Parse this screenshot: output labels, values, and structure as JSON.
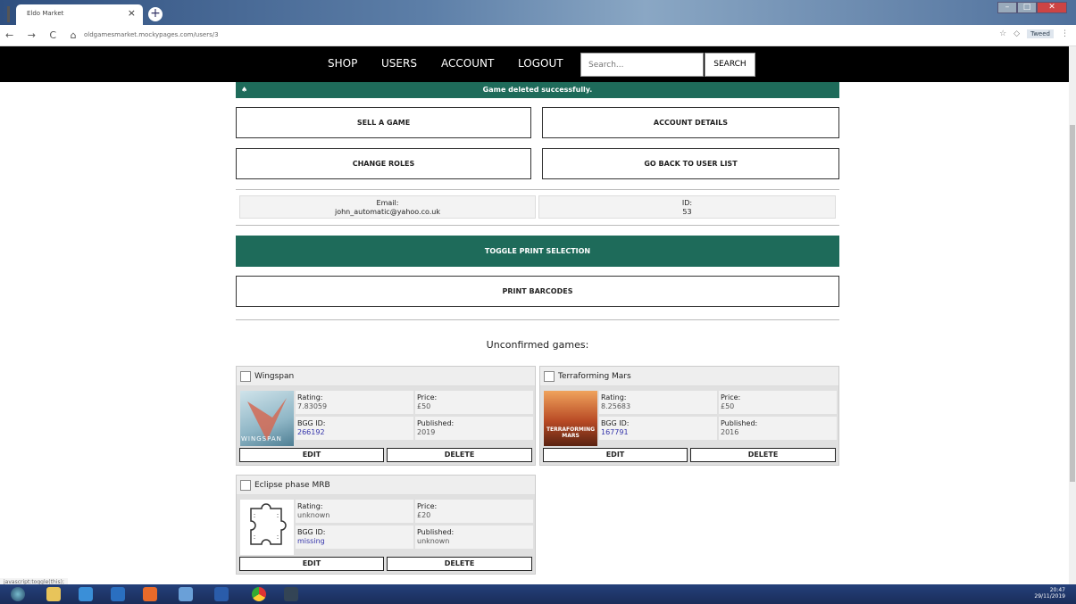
{
  "browser": {
    "tab_title": "Eldo Market",
    "tab_close": "×",
    "new_tab": "+",
    "nav_glyphs": "← → C ⌂",
    "url": "oldgamesmarket.mockypages.com/users/3",
    "toolbar_label": "Tweed",
    "window_min": "–",
    "window_max": "□",
    "window_close": "✕"
  },
  "nav": {
    "shop": "SHOP",
    "users": "USERS",
    "account": "ACCOUNT",
    "logout": "LOGOUT",
    "search_placeholder": "Search...",
    "search_button": "SEARCH"
  },
  "flash": {
    "icon": "♠",
    "message": "Game deleted successfully."
  },
  "actions": {
    "sell": "SELL A GAME",
    "account_details": "ACCOUNT DETAILS",
    "change_roles": "CHANGE ROLES",
    "back": "GO BACK TO USER LIST"
  },
  "user": {
    "email_label": "Email:",
    "email": "john_automatic@yahoo.co.uk",
    "id_label": "ID:",
    "id": "53"
  },
  "toggle_print": "TOGGLE PRINT SELECTION",
  "print_barcodes": "PRINT BARCODES",
  "unconfirmed_heading": "Unconfirmed games:",
  "labels": {
    "rating": "Rating:",
    "price": "Price:",
    "bgg": "BGG ID:",
    "published": "Published:",
    "edit": "EDIT",
    "delete": "DELETE"
  },
  "games": [
    {
      "name": "Wingspan",
      "rating": "7.83059",
      "price": "£50",
      "bgg_id": "266192",
      "published": "2019",
      "cover_text": "WINGSPAN"
    },
    {
      "name": "Terraforming Mars",
      "rating": "8.25683",
      "price": "£50",
      "bgg_id": "167791",
      "published": "2016",
      "cover_text": "TERRAFORMING MARS"
    },
    {
      "name": "Eclipse phase MRB",
      "rating": "unknown",
      "price": "£20",
      "bgg_id": "missing",
      "published": "unknown",
      "cover_text": ""
    }
  ],
  "status_text": "javascript:toggle(this);",
  "clock": {
    "time": "20:47",
    "date": "29/11/2019"
  },
  "colors": {
    "accent": "#1e6b5a",
    "nav_bg": "#000000"
  }
}
